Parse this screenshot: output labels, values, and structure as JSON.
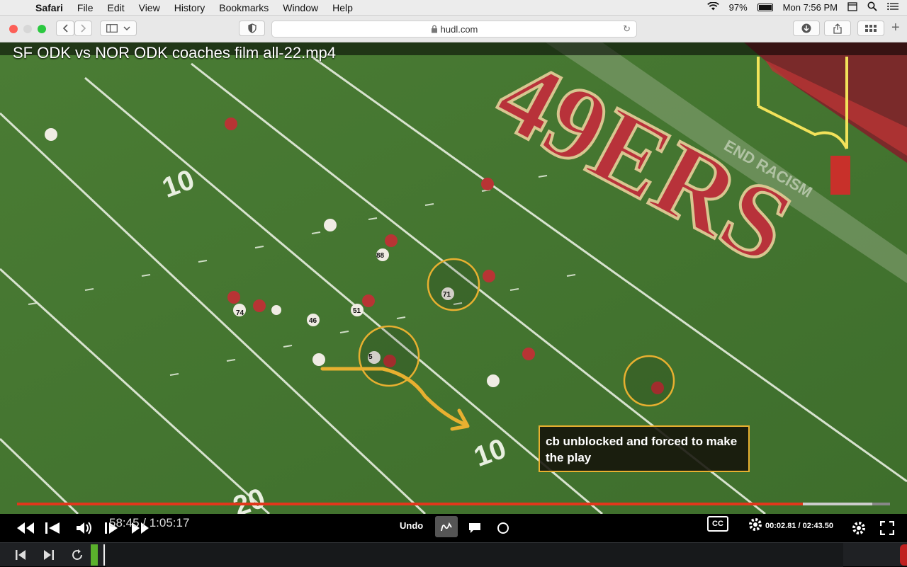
{
  "menubar": {
    "app_name": "Safari",
    "items": [
      "File",
      "Edit",
      "View",
      "History",
      "Bookmarks",
      "Window",
      "Help"
    ],
    "battery_percent": "97%",
    "clock": "Mon 7:56 PM"
  },
  "browser": {
    "url": "hudl.com"
  },
  "video": {
    "title": "SF ODK vs NOR ODK coaches film all-22.mp4",
    "annotation_text": "cb unblocked and forced to make the play",
    "field_markings": {
      "yard_10_left": "10",
      "yard_10_center": "10",
      "yard_20": "20",
      "endzone_text": "49ERS",
      "banner_text": "END RACISM",
      "player_numbers": [
        "74",
        "46",
        "51",
        "71",
        "88",
        "5"
      ]
    },
    "colors": {
      "annotation_accent": "#e8b030",
      "progress_played": "#e2371b",
      "field_green": "#3c6b2d",
      "endzone_red": "#b8323a"
    }
  },
  "player": {
    "elapsed_time": "58:45 / 1:05:17",
    "progress_fraction": 0.9,
    "buffer_fraction": 0.98,
    "undo_label": "Undo",
    "clip_time": "00:02.81 / 02:43.50",
    "cc_label": "CC",
    "icons": [
      "rewind-icon",
      "skip-back-icon",
      "volume-icon",
      "play-icon",
      "fast-forward-icon",
      "draw-icon",
      "comment-icon",
      "circle-icon",
      "cc-icon",
      "settings-icon",
      "fullscreen-icon"
    ]
  },
  "bottombar": {
    "icons": [
      "previous-icon",
      "next-icon",
      "repeat-icon"
    ]
  }
}
